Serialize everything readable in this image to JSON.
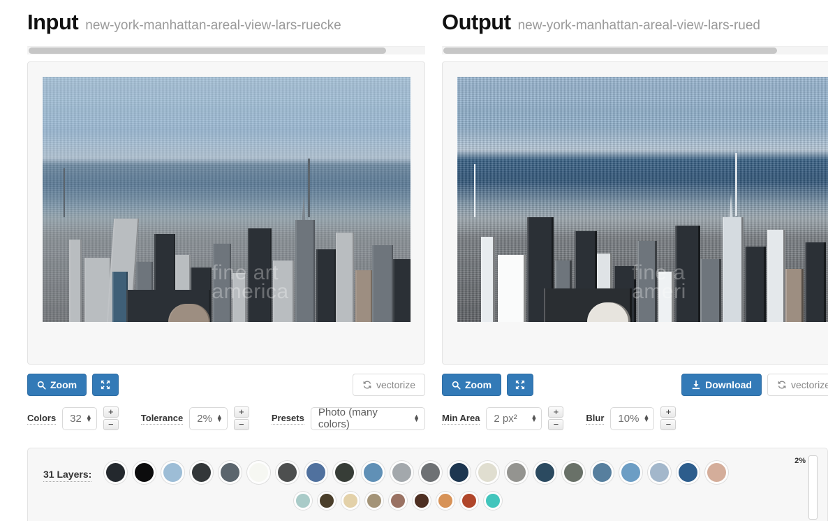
{
  "input_panel": {
    "title": "Input",
    "filename": "new-york-manhattan-areal-view-lars-ruecke",
    "image_alt": "Aerial view of Manhattan skyline with Empire State Building",
    "watermark_line1": "fine art",
    "watermark_line2": "america",
    "buttons": {
      "zoom_label": "Zoom",
      "fullscreen_label": "",
      "vectorize_label": "vectorize"
    },
    "controls": [
      {
        "name": "colors",
        "label": "Colors",
        "value": "32",
        "plus": "+",
        "minus": "−"
      },
      {
        "name": "tolerance",
        "label": "Tolerance",
        "value": "2%",
        "plus": "+",
        "minus": "−"
      },
      {
        "name": "presets",
        "label": "Presets",
        "value": "Photo (many colors)"
      }
    ]
  },
  "output_panel": {
    "title": "Output",
    "filename": "new-york-manhattan-areal-view-lars-rued",
    "image_alt": "Vectorized posterized version of Manhattan skyline",
    "watermark_line1": "fine a",
    "watermark_line2": "ameri",
    "buttons": {
      "zoom_label": "Zoom",
      "fullscreen_label": "",
      "download_label": "Download",
      "vectorize_label": "vectorize"
    },
    "controls": [
      {
        "name": "min-area",
        "label": "Min Area",
        "value": "2 px²",
        "plus": "+",
        "minus": "−"
      },
      {
        "name": "blur",
        "label": "Blur",
        "value": "10%",
        "plus": "+",
        "minus": "−"
      }
    ]
  },
  "layers_panel": {
    "label": "31 Layers:",
    "count": 31,
    "slider_percent": "2%",
    "row1_colors": [
      "#23282d",
      "#0c0c0d",
      "#9dbdd6",
      "#333739",
      "#5b656d",
      "#f6f7f2",
      "#4d4f4f",
      "#50719e",
      "#373d37",
      "#6090b6",
      "#a3a8ac",
      "#6e7174",
      "#1d3650",
      "#e0ded0",
      "#949490",
      "#2b4a60",
      "#697168",
      "#577f9e",
      "#6c9dc4",
      "#a3b7cb",
      "#2d5d8c",
      "#d4ad9a"
    ],
    "row2_colors": [
      "#a9cbc8",
      "#4a3e2a",
      "#e3d1a9",
      "#a39377",
      "#9a7263",
      "#4e2f22",
      "#d79257",
      "#b0462a",
      "#42c5bc"
    ]
  },
  "icons": {
    "search": "search-icon",
    "fullscreen": "fullscreen-icon",
    "refresh": "refresh-icon",
    "download": "download-icon",
    "spinner_up": "▲",
    "spinner_down": "▼"
  },
  "theme": {
    "primary": "#337ab7",
    "panel_bg": "#f7f7f7",
    "border": "#e3e3e3",
    "muted_text": "#9a9a9a"
  }
}
